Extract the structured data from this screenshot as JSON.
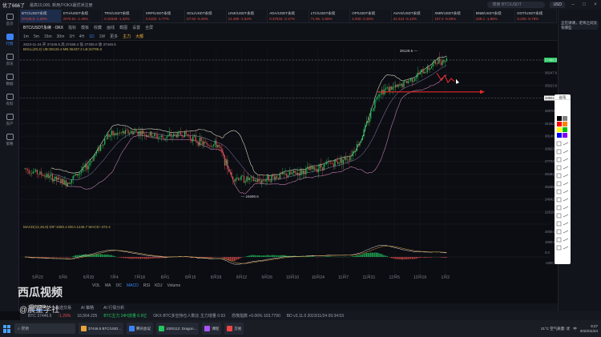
{
  "app": {
    "title": "优了666了",
    "notice": "最高10,000, 新用户OKX最优米注册"
  },
  "topbar": {
    "search_placeholder": "搜索 BTC/USDT",
    "currency": "USD"
  },
  "nav": [
    {
      "label": "首页",
      "icon": "home-icon"
    },
    {
      "label": "行情",
      "icon": "chart-icon"
    },
    {
      "label": "资讯",
      "icon": "news-icon"
    },
    {
      "label": "数据",
      "icon": "data-icon"
    },
    {
      "label": "有料",
      "icon": "fire-icon"
    },
    {
      "label": "资产",
      "icon": "wallet-icon"
    },
    {
      "label": "策略",
      "icon": "robot-icon"
    }
  ],
  "tickers": [
    {
      "name": "BTC/USDT永续",
      "price": "37446.5 -1.29%"
    },
    {
      "name": "ETH/USDT永续",
      "price": "2070.61 -1.49%"
    },
    {
      "name": "TRX/USDT永续",
      "price": "0.10336 -1.32%"
    },
    {
      "name": "XRP/USDT永续",
      "price": "0.6102 -1.77%"
    },
    {
      "name": "SOL/USDT永续",
      "price": "57.62 -5.26%"
    },
    {
      "name": "LINK/USDT永续",
      "price": "14.486 -1.64%"
    },
    {
      "name": "ADA/USDT永续",
      "price": "0.37644 -3.17%"
    },
    {
      "name": "LTC/USDT永续",
      "price": "71.96 -1.55%"
    },
    {
      "name": "OP/USDT永续",
      "price": "1.930 -2.30%"
    },
    {
      "name": "AVAX/USDT永续",
      "price": "22.424 -5.13%"
    },
    {
      "name": "XMR/USDT永续",
      "price": "157.4 -5.65%"
    },
    {
      "name": "BNB/USDT永续",
      "price": "228.1 -1.85%"
    },
    {
      "name": "DOT/USDT永续",
      "price": "5.225 -5.78%"
    }
  ],
  "toolbar": {
    "row1": [
      "指标",
      "模板",
      "收藏",
      "画线",
      "截图",
      "设置",
      "全屏"
    ],
    "row2": [
      "1m",
      "5m",
      "15m",
      "30m",
      "1H",
      "4H",
      "1D",
      "1W",
      "更多",
      "主力",
      "大额"
    ],
    "symbol_line": "BTC/USDT永续 · OKX",
    "ohlc_line": "2023-11-24  开 37446.5  高 37468.4  低 37306.0  收 37446.5",
    "boll_line": "BOLL(20,2)  UB:38133.4  MB:36437.2  LB:34795.0"
  },
  "chart_data": {
    "type": "candlestick",
    "x_ticks": [
      "5月23",
      "6月6",
      "6月20",
      "7月4",
      "7月18",
      "8月1",
      "8月15",
      "8月29",
      "9月12",
      "9月26",
      "10月10",
      "10月24",
      "11月7",
      "11月21",
      "12月5",
      "12月19",
      "1月2"
    ],
    "y_ticks": [
      37466.5,
      36247.0,
      35023.6,
      33802.4,
      32576.9,
      31362.0,
      30140.1,
      28923.6,
      27702.1,
      26481.4,
      25259.4,
      24042.9,
      22818.6
    ],
    "ylim": [
      22200,
      38700
    ],
    "annotations": {
      "high": "38129.5",
      "low": "24690.6"
    },
    "current_price": 37466.5,
    "target_level": 33802.4,
    "macd_label": "MACD(12,26,9)  DIF:1060.4  DEA:1246.7  MACD:-372.4",
    "macd_ticks": [
      "2000.0",
      "1000.0",
      "0.0",
      "-1000.0"
    ]
  },
  "indicators": [
    "VOL",
    "MA",
    "OC",
    "MACD",
    "RSI",
    "KDJ",
    "Volume"
  ],
  "bottom_tabs": [
    "历史订单",
    "自选交易",
    "AI 策略",
    "AI 行情分析"
  ],
  "statusbar": {
    "btc": "BTC 37446.5",
    "chg": "-1.29%",
    "vol": "16,564.225",
    "funding": "BTC主力 24H流量 6.9亿",
    "okx": "OKX·BTC多空持仓人数比 主力增量 0.93",
    "fear": "恐慌指数 +0.06%  103.7790",
    "version": "BD v3.11.6  2023/11/24 09:34:53"
  },
  "taskbar": {
    "search": "搜索",
    "apps": [
      "37446.5 BTC/USD...",
      "腾讯会议",
      "1000112: Dragon...",
      "课程",
      "交易"
    ],
    "weather": "21°C  空气质量: 优",
    "ime": "中",
    "time": "9:27",
    "date": "2023/11/24"
  },
  "watermark": {
    "brand": "西瓜视频",
    "handle": "@晨星学社"
  },
  "sidepanel": {
    "ask": "正在讲课，老师之间没有哪些"
  },
  "palette": {
    "title": "画笔"
  }
}
